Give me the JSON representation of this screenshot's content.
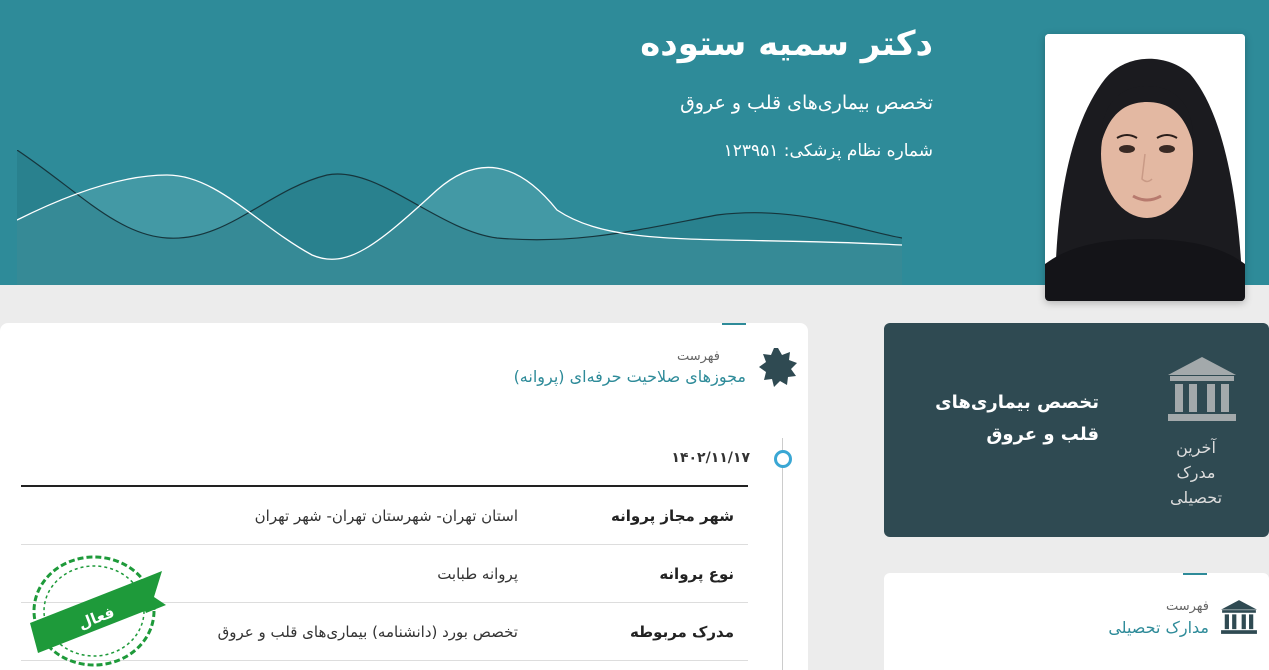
{
  "header": {
    "name": "دکتر سمیه ستوده",
    "specialty": "تخصص بیماری‌های قلب و عروق",
    "medical_number": "شماره نظام پزشکی: ۱۲۳۹۵۱"
  },
  "licenses": {
    "label": "فهرست",
    "title": "مجوزهای صلاحیت حرفه‌ای (پروانه)",
    "date": "۱۴۰۲/۱۱/۱۷",
    "rows": [
      {
        "key": "شهر مجاز پروانه",
        "value": "استان تهران- شهرستان تهران- شهر تهران"
      },
      {
        "key": "نوع پروانه",
        "value": "پروانه طبابت"
      },
      {
        "key": "مدرک مربوطه",
        "value": "تخصص بورد (دانشنامه) بیماری‌های قلب و عروق"
      }
    ],
    "stamp": "فعال"
  },
  "education_card": {
    "caption_line1": "آخرین",
    "caption_line2": "مدرک",
    "caption_line3": "تحصیلی",
    "spec_line1": "تخصص بیماری‌های",
    "spec_line2": "قلب و عروق"
  },
  "degrees": {
    "label": "فهرست",
    "title": "مدارک تحصیلی"
  },
  "colors": {
    "header": "#2e8b99",
    "dark_card": "#2f4a52",
    "accent": "#3aa7d4",
    "stamp_green": "#1e9a3a"
  }
}
